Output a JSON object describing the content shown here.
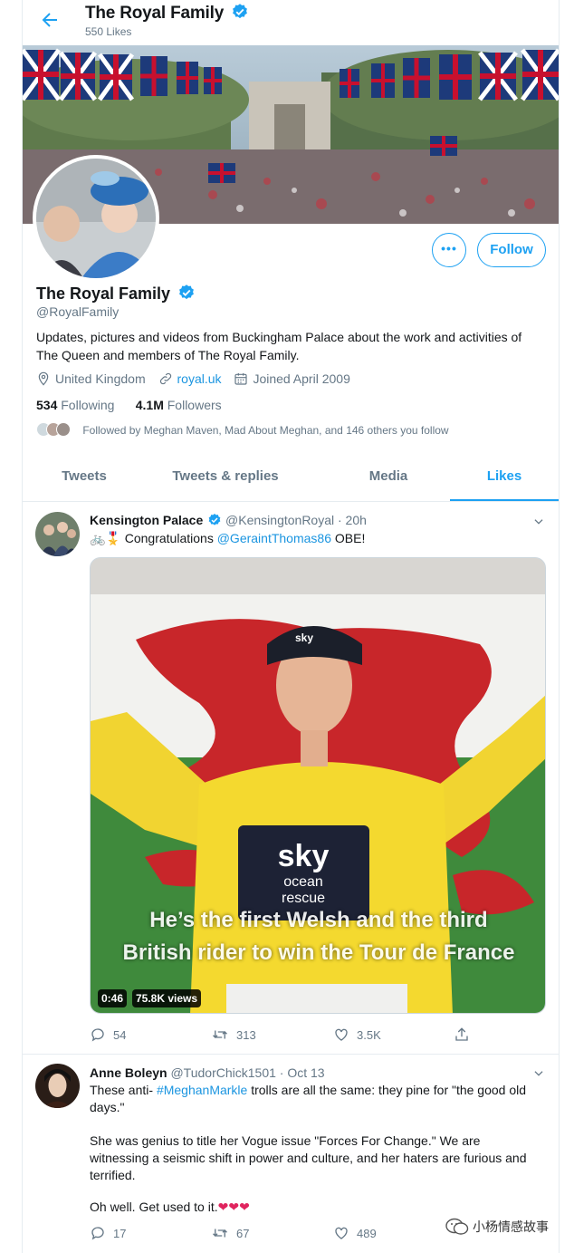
{
  "header": {
    "title": "The Royal Family",
    "likes_count": "550 Likes"
  },
  "profile": {
    "name": "The Royal Family",
    "handle": "@RoyalFamily",
    "bio": "Updates, pictures and videos from Buckingham Palace about the work and activities of The Queen and members of The Royal Family.",
    "location": "United Kingdom",
    "website": "royal.uk",
    "joined": "Joined April 2009",
    "following_count": "534",
    "following_label": "Following",
    "followers_count": "4.1M",
    "followers_label": "Followers",
    "followed_by": "Followed by Meghan Maven, Mad About Meghan, and 146 others you follow",
    "more_label": "•••",
    "follow_label": "Follow"
  },
  "tabs": [
    {
      "label": "Tweets",
      "active": false
    },
    {
      "label": "Tweets & replies",
      "active": false
    },
    {
      "label": "Media",
      "active": false
    },
    {
      "label": "Likes",
      "active": true
    }
  ],
  "tweets": [
    {
      "author": "Kensington Palace",
      "handle": "@KensingtonRoyal",
      "time": "· 20h",
      "text_prefix": "🚲🎖️ Congratulations ",
      "mention": "@GeraintThomas86",
      "text_suffix": " OBE!",
      "media": {
        "caption_line1": "He’s the first Welsh and the third",
        "caption_line2": "British rider to win the Tour de France",
        "duration": "0:46",
        "views": "75.8K views",
        "jersey_text": "sky",
        "jersey_sub1": "ocean",
        "jersey_sub2": "rescue",
        "cap_text": "sky"
      },
      "replies": "54",
      "retweets": "313",
      "likes": "3.5K"
    },
    {
      "author": "Anne Boleyn",
      "handle": "@TudorChick1501",
      "time": "· Oct 13",
      "line1_prefix": "These anti- ",
      "hashtag": "#MeghanMarkle",
      "line1_suffix": " trolls are all the same: they pine for \"the good old days.\"",
      "para2": "She was genius to title her Vogue issue \"Forces For Change.\" We are witnessing a seismic shift in power and culture, and her haters are furious and terrified.",
      "para3": "Oh well. Get used to it.",
      "hearts": "❤❤❤",
      "replies": "17",
      "retweets": "67",
      "likes": "489"
    }
  ],
  "watermark": {
    "text": "小杨情感故事"
  },
  "colors": {
    "accent": "#1da1f2",
    "text": "#14171a",
    "secondary": "#657786",
    "border": "#e6ecf0",
    "heart": "#e0245e"
  }
}
